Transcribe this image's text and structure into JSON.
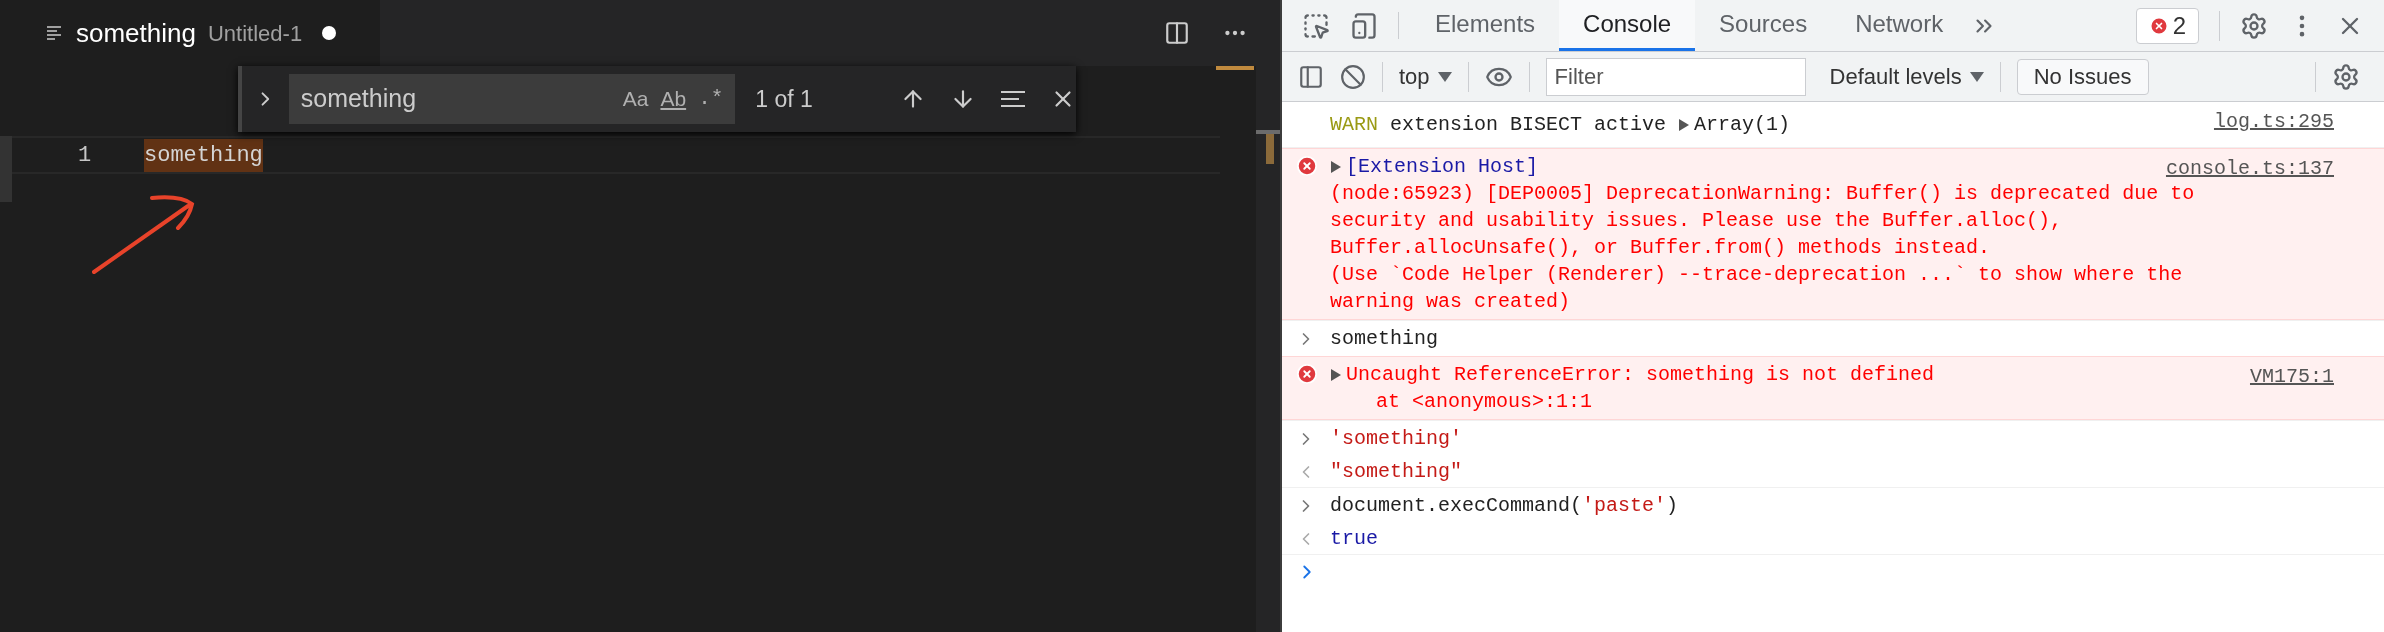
{
  "editor": {
    "tab": {
      "title": "something",
      "subtitle": "Untitled-1",
      "dirty": true
    },
    "find_widget": {
      "query": "something",
      "options": [
        "Aa",
        "Ab",
        ".*"
      ],
      "match_count": "1 of 1"
    },
    "lines": [
      {
        "number": "1",
        "text": "something",
        "highlighted": true
      }
    ]
  },
  "devtools": {
    "tabs": [
      {
        "label": "Elements",
        "selected": false
      },
      {
        "label": "Console",
        "selected": true
      },
      {
        "label": "Sources",
        "selected": false
      },
      {
        "label": "Network",
        "selected": false
      }
    ],
    "error_count": "2",
    "toolbar": {
      "context": "top",
      "filter_placeholder": "Filter",
      "levels": "Default levels",
      "issues": "No Issues"
    },
    "messages": [
      {
        "kind": "warn",
        "label": "WARN",
        "text": "extension BISECT active",
        "object": "Array(1)",
        "source": "log.ts:295"
      },
      {
        "kind": "error",
        "title": "[Extension Host]",
        "title_link": true,
        "lines": [
          "(node:65923) [DEP0005] DeprecationWarning: Buffer() is deprecated due to",
          "security and usability issues. Please use the Buffer.alloc(),",
          "Buffer.allocUnsafe(), or Buffer.from() methods instead.",
          "(Use `Code Helper (Renderer) --trace-deprecation ...` to show where the",
          "warning was created)"
        ],
        "source": "console.ts:137"
      },
      {
        "kind": "input",
        "tokens": [
          {
            "kind": "code",
            "text": "something"
          }
        ]
      },
      {
        "kind": "error",
        "title": "Uncaught ReferenceError: something is not defined",
        "title_link": false,
        "stack": [
          "at <anonymous>:1:1"
        ],
        "source": "VM175:1"
      },
      {
        "kind": "input",
        "tokens": [
          {
            "kind": "string",
            "text": "'something'"
          }
        ]
      },
      {
        "kind": "result",
        "tokens": [
          {
            "kind": "string",
            "text": "\"something\""
          }
        ]
      },
      {
        "kind": "input",
        "tokens": [
          {
            "kind": "code",
            "text": "document.execCommand("
          },
          {
            "kind": "string",
            "text": "'paste'"
          },
          {
            "kind": "code",
            "text": ")"
          }
        ]
      },
      {
        "kind": "result",
        "tokens": [
          {
            "kind": "keyword",
            "text": "true"
          }
        ]
      },
      {
        "kind": "prompt"
      }
    ]
  }
}
